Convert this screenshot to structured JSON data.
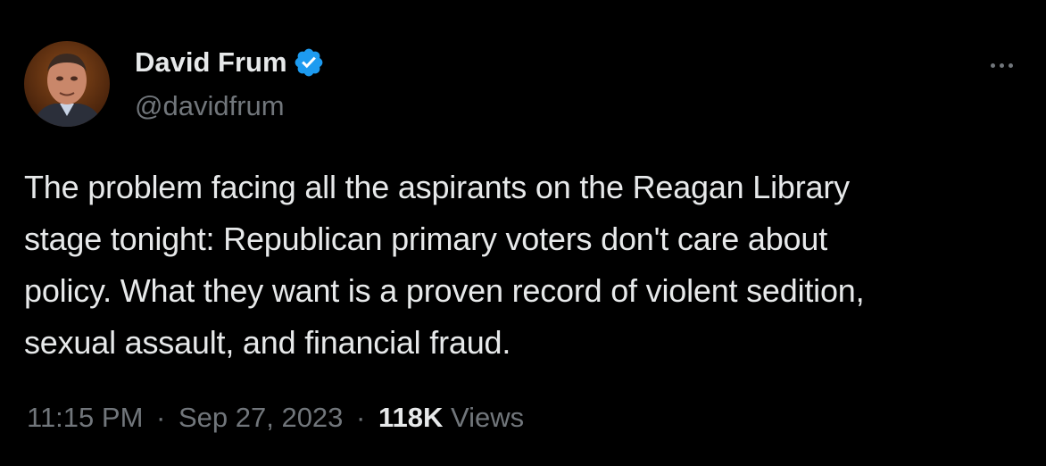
{
  "author": {
    "display_name": "David Frum",
    "handle": "@davidfrum",
    "verified": true,
    "verified_color": "#1d9bf0"
  },
  "tweet": {
    "text": "The problem facing all the aspirants on the Reagan Library\nstage tonight: Republican primary voters don't care about\npolicy. What they want is a proven record of violent sedition,\nsexual assault, and financial fraud.",
    "time": "11:15 PM",
    "separator": "·",
    "date": "Sep 27, 2023",
    "views_count": "118K",
    "views_label": "Views"
  },
  "icons": {
    "more": "more-horizontal-icon",
    "verified": "verified-badge-icon"
  },
  "colors": {
    "background": "#000000",
    "primary_text": "#e7e9ea",
    "secondary_text": "#71767b"
  }
}
